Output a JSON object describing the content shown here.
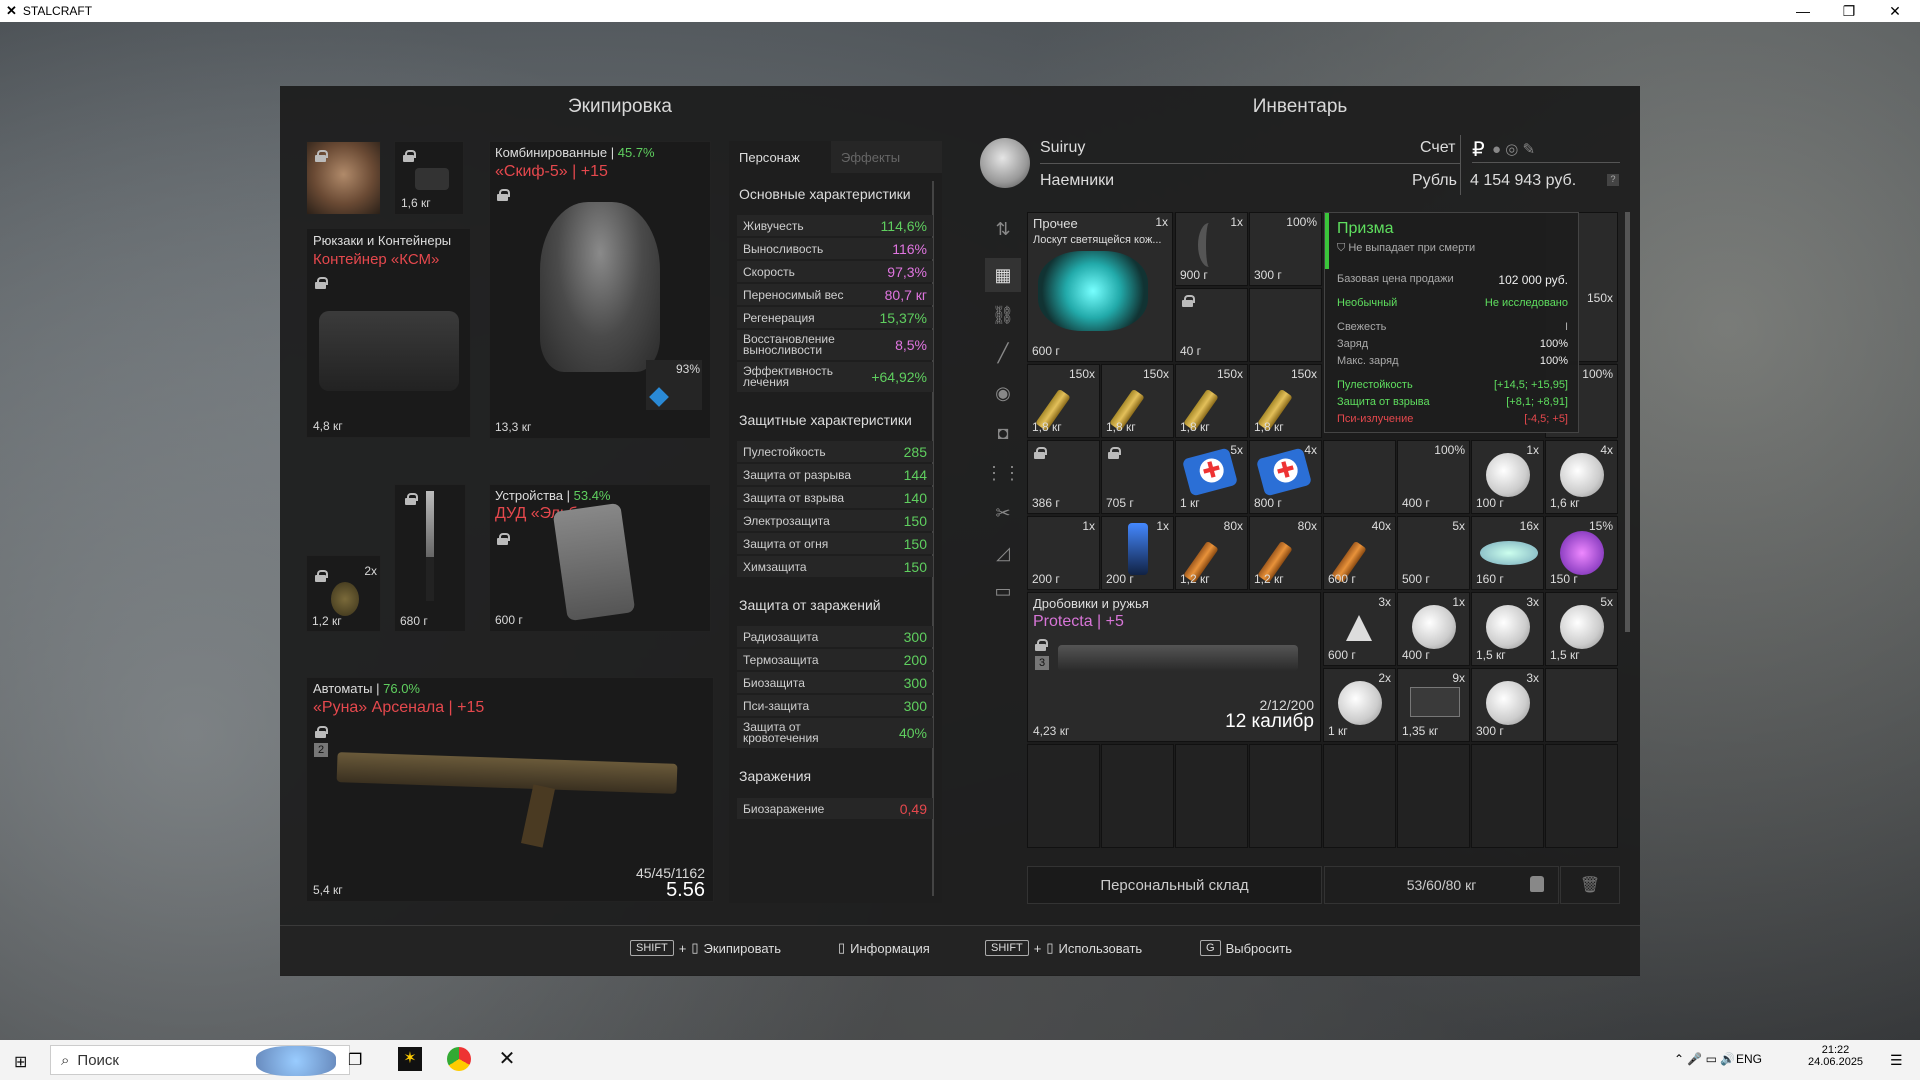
{
  "window": {
    "title": "STALCRAFT"
  },
  "equipment": {
    "title": "Экипировка",
    "helmet_weight": "1,6 кг",
    "armor": {
      "category": "Комбинированные |",
      "percent": "45.7%",
      "name": "«Скиф-5» | +15",
      "weight": "13,3 кг",
      "mod": "93%"
    },
    "backpack": {
      "category": "Рюкзаки и Контейнеры",
      "name": "Контейнер «КСМ»",
      "weight": "4,8 кг"
    },
    "grenade": {
      "count": "2x",
      "weight": "1,2 кг"
    },
    "knife": {
      "weight": "680 г"
    },
    "device": {
      "category": "Устройства |",
      "percent": "53.4%",
      "name": "ДУД «Эльбрус»",
      "weight": "600 г"
    },
    "rifle": {
      "category": "Автоматы |",
      "percent": "76.0%",
      "name": "«Руна» Арсенала | +15",
      "weight": "5,4 кг",
      "ammo": "45/45/1162",
      "caliber": "5.56",
      "slot": "2"
    }
  },
  "stats": {
    "tab_character": "Персонаж",
    "tab_effects": "Эффекты",
    "main_title": "Основные характеристики",
    "main": [
      {
        "label": "Живучесть",
        "value": "114,6%",
        "c": "green"
      },
      {
        "label": "Выносливость",
        "value": "116%",
        "c": "pink"
      },
      {
        "label": "Скорость",
        "value": "97,3%",
        "c": "pink"
      },
      {
        "label": "Переносимый вес",
        "value": "80,7 кг",
        "c": "pink"
      },
      {
        "label": "Регенерация",
        "value": "15,37%",
        "c": "green"
      },
      {
        "label": "Восстановление выносливости",
        "value": "8,5%",
        "c": "pink"
      },
      {
        "label": "Эффективность лечения",
        "value": "+64,92%",
        "c": "green"
      }
    ],
    "prot_title": "Защитные характеристики",
    "prot": [
      {
        "label": "Пулестойкость",
        "value": "285"
      },
      {
        "label": "Защита от разрыва",
        "value": "144"
      },
      {
        "label": "Защита от взрыва",
        "value": "140"
      },
      {
        "label": "Электрозащита",
        "value": "150"
      },
      {
        "label": "Защита от огня",
        "value": "150"
      },
      {
        "label": "Химзащита",
        "value": "150"
      }
    ],
    "cont_title": "Защита от заражений",
    "cont": [
      {
        "label": "Радиозащита",
        "value": "300"
      },
      {
        "label": "Термозащита",
        "value": "200"
      },
      {
        "label": "Биозащита",
        "value": "300"
      },
      {
        "label": "Пси-защита",
        "value": "300"
      },
      {
        "label": "Защита от кровотечения",
        "value": "40%"
      }
    ],
    "inf_title": "Заражения",
    "inf": [
      {
        "label": "Биозаражение",
        "value": "0,49"
      }
    ]
  },
  "inventory": {
    "title": "Инвентарь",
    "player": "Suiruy",
    "faction": "Наемники",
    "account_label": "Счет",
    "currency_label": "Рубль",
    "balance": "4 154 943 руб.",
    "misc_category": "Прочее",
    "misc_count": "1x",
    "misc_name": "Лоскут светящейся кож...",
    "misc_weight": "600 г",
    "shotgun_category": "Дробовики и ружья",
    "shotgun_name": "Protecta | +5",
    "shotgun_weight": "4,23 кг",
    "shotgun_ammo": "2/12/200",
    "shotgun_caliber": "12 калибр",
    "shotgun_slot": "3",
    "items": [
      {
        "q": "1x",
        "w": "900 г"
      },
      {
        "q": "100%",
        "w": "300 г"
      },
      {
        "q": "",
        "w": "40 г"
      },
      {
        "q": "150x",
        "w": "1,8 кг"
      },
      {
        "q": "150x",
        "w": "1,8 кг"
      },
      {
        "q": "150x",
        "w": "1,8 кг"
      },
      {
        "q": "150x",
        "w": "1,8 кг"
      },
      {
        "q": "",
        "w": "386 г"
      },
      {
        "q": "",
        "w": "705 г"
      },
      {
        "q": "5x",
        "w": "1 кг"
      },
      {
        "q": "4x",
        "w": "800 г"
      },
      {
        "q": "100%",
        "w": "400 г"
      },
      {
        "q": "1x",
        "w": "100 г"
      },
      {
        "q": "4x",
        "w": "1,6 кг"
      },
      {
        "q": "1x",
        "w": "200 г"
      },
      {
        "q": "1x",
        "w": "200 г"
      },
      {
        "q": "80x",
        "w": "1,2 кг"
      },
      {
        "q": "80x",
        "w": "1,2 кг"
      },
      {
        "q": "40x",
        "w": "600 г"
      },
      {
        "q": "5x",
        "w": "500 г"
      },
      {
        "q": "16x",
        "w": "160 г"
      },
      {
        "q": "15%",
        "w": "150 г"
      },
      {
        "q": "3x",
        "w": "600 г"
      },
      {
        "q": "1x",
        "w": "400 г"
      },
      {
        "q": "3x",
        "w": "1,5 кг"
      },
      {
        "q": "5x",
        "w": "1,5 кг"
      },
      {
        "q": "2x",
        "w": "1 кг"
      },
      {
        "q": "9x",
        "w": "1,35 кг"
      },
      {
        "q": "3x",
        "w": "300 г"
      }
    ],
    "partial": {
      "q1": "150x",
      "q2": "100%"
    },
    "storage": "Персональный склад",
    "weight": "53/60/80 кг"
  },
  "tooltip": {
    "name": "Призма",
    "nodrop": "Не выпадает при смерти",
    "price_label": "Базовая цена продажи",
    "price": "102 000 руб.",
    "rarity": "Необычный",
    "research": "Не исследовано",
    "fresh_label": "Свежесть",
    "fresh": "I",
    "charge_label": "Заряд",
    "charge": "100%",
    "max_label": "Макс. заряд",
    "max": "100%",
    "props": [
      {
        "label": "Пулестойкость",
        "value": "[+14,5; +15,95]",
        "c": "green"
      },
      {
        "label": "Защита от взрыва",
        "value": "[+8,1; +8,91]",
        "c": "green"
      },
      {
        "label": "Пси-излучение",
        "value": "[-4,5; +5]",
        "c": "red"
      }
    ]
  },
  "footer": {
    "shift": "SHIFT",
    "plus": "+",
    "equip": "Экипировать",
    "info": "Информация",
    "use": "Использовать",
    "g": "G",
    "drop": "Выбросить"
  },
  "taskbar": {
    "search": "Поиск",
    "lang": "ENG",
    "time": "21:22",
    "date": "24.06.2025"
  }
}
